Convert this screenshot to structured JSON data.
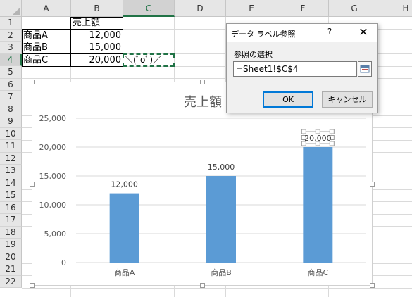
{
  "columns": [
    "A",
    "B",
    "C",
    "D",
    "E",
    "F",
    "G",
    "H"
  ],
  "rows": [
    "1",
    "2",
    "3",
    "4",
    "5",
    "6",
    "7",
    "8",
    "9",
    "10",
    "11",
    "12",
    "13",
    "14",
    "15",
    "16",
    "17",
    "18",
    "19",
    "20",
    "21",
    "22"
  ],
  "cells": {
    "B1": "売上額",
    "A2": "商品A",
    "B2": "12,000",
    "A3": "商品B",
    "B3": "15,000",
    "A4": "商品C",
    "B4": "20,000",
    "C4": "＼(ﾟoﾟ)／"
  },
  "selected_cell": "C4",
  "chart_data": {
    "type": "bar",
    "title": "売上額",
    "categories": [
      "商品A",
      "商品B",
      "商品C"
    ],
    "values": [
      12000,
      15000,
      20000
    ],
    "data_labels": [
      "12,000",
      "15,000",
      "20,000"
    ],
    "y_ticks": [
      "0",
      "5,000",
      "10,000",
      "15,000",
      "20,000",
      "25,000"
    ],
    "ylim": [
      0,
      25000
    ],
    "grid": true,
    "bar_color": "#5b9bd5",
    "selected_label": "20,000"
  },
  "dialog": {
    "title": "データ ラベル参照",
    "help": "?",
    "close": "✕",
    "label": "参照の選択",
    "input_value": "=Sheet1!$C$4",
    "ok": "OK",
    "cancel": "キャンセル"
  },
  "colors": {
    "accent": "#217346",
    "dialog_focus": "#0078d7"
  }
}
